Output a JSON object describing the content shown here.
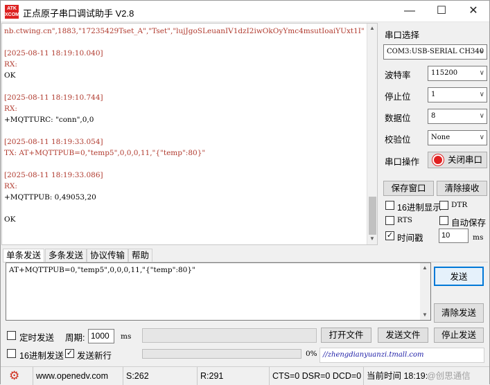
{
  "app": {
    "icon_text": [
      "ATK",
      "XCOM"
    ],
    "title": "正点原子串口调试助手 V2.8"
  },
  "window_controls": {
    "minimize": "—",
    "maximize": "☐",
    "close": "✕"
  },
  "receive": {
    "lines": [
      {
        "text": "nb.ctwing.cn\",1883,\"17235429Tset_A\",\"Tset\",\"lujJgoSLeuanIV1dzI2iwOkOyYmc4msutIoaiYUxt1I\"",
        "color": "red"
      },
      {
        "text": "",
        "color": "black"
      },
      {
        "text": "[2025-08-11 18:19:10.040]",
        "color": "red"
      },
      {
        "text": "RX:",
        "color": "red"
      },
      {
        "text": "OK",
        "color": "black"
      },
      {
        "text": "",
        "color": "black"
      },
      {
        "text": "[2025-08-11 18:19:10.744]",
        "color": "red"
      },
      {
        "text": "RX:",
        "color": "red"
      },
      {
        "text": "+MQTTURC: \"conn\",0,0",
        "color": "black"
      },
      {
        "text": "",
        "color": "black"
      },
      {
        "text": "[2025-08-11 18:19:33.054]",
        "color": "red"
      },
      {
        "text": "TX: AT+MQTTPUB=0,\"temp5\",0,0,0,11,\"{\"temp\":80}\"",
        "color": "red"
      },
      {
        "text": "",
        "color": "black"
      },
      {
        "text": "[2025-08-11 18:19:33.086]",
        "color": "red"
      },
      {
        "text": "RX:",
        "color": "red"
      },
      {
        "text": "+MQTTPUB: 0,49053,20",
        "color": "black"
      },
      {
        "text": "",
        "color": "black"
      },
      {
        "text": "OK",
        "color": "black"
      }
    ]
  },
  "settings": {
    "port_label": "串口选择",
    "port_value": "COM3:USB-SERIAL CH340",
    "baud_label": "波特率",
    "baud_value": "115200",
    "stop_label": "停止位",
    "stop_value": "1",
    "data_label": "数据位",
    "data_value": "8",
    "parity_label": "校验位",
    "parity_value": "None",
    "op_label": "串口操作",
    "op_button": "关闭串口",
    "save_window": "保存窗口",
    "clear_receive": "清除接收",
    "hex_display": "16进制显示",
    "dtr": "DTR",
    "rts": "RTS",
    "auto_save": "自动保存",
    "timestamp": "时间戳",
    "timestamp_value": "10",
    "ms": "ms"
  },
  "tabs": [
    "单条发送",
    "多条发送",
    "协议传输",
    "帮助"
  ],
  "send": {
    "text": "AT+MQTTPUB=0,\"temp5\",0,0,0,11,\"{\"temp\":80}\"",
    "send_button": "发送",
    "clear_button": "清除发送",
    "timed_send": "定时发送",
    "period_label": "周期:",
    "period_value": "1000",
    "period_unit": "ms",
    "open_file": "打开文件",
    "send_file": "发送文件",
    "stop_send": "停止发送",
    "hex_send": "16进制发送",
    "send_newline": "发送新行",
    "progress": "0%",
    "url": "//zhengdianyuanzi.tmall.com"
  },
  "statusbar": {
    "website": "www.openedv.com",
    "sent": "S:262",
    "received": "R:291",
    "lines": "CTS=0 DSR=0 DCD=0",
    "time": "当前时间 18:19:",
    "watermark": "@创思通信"
  }
}
